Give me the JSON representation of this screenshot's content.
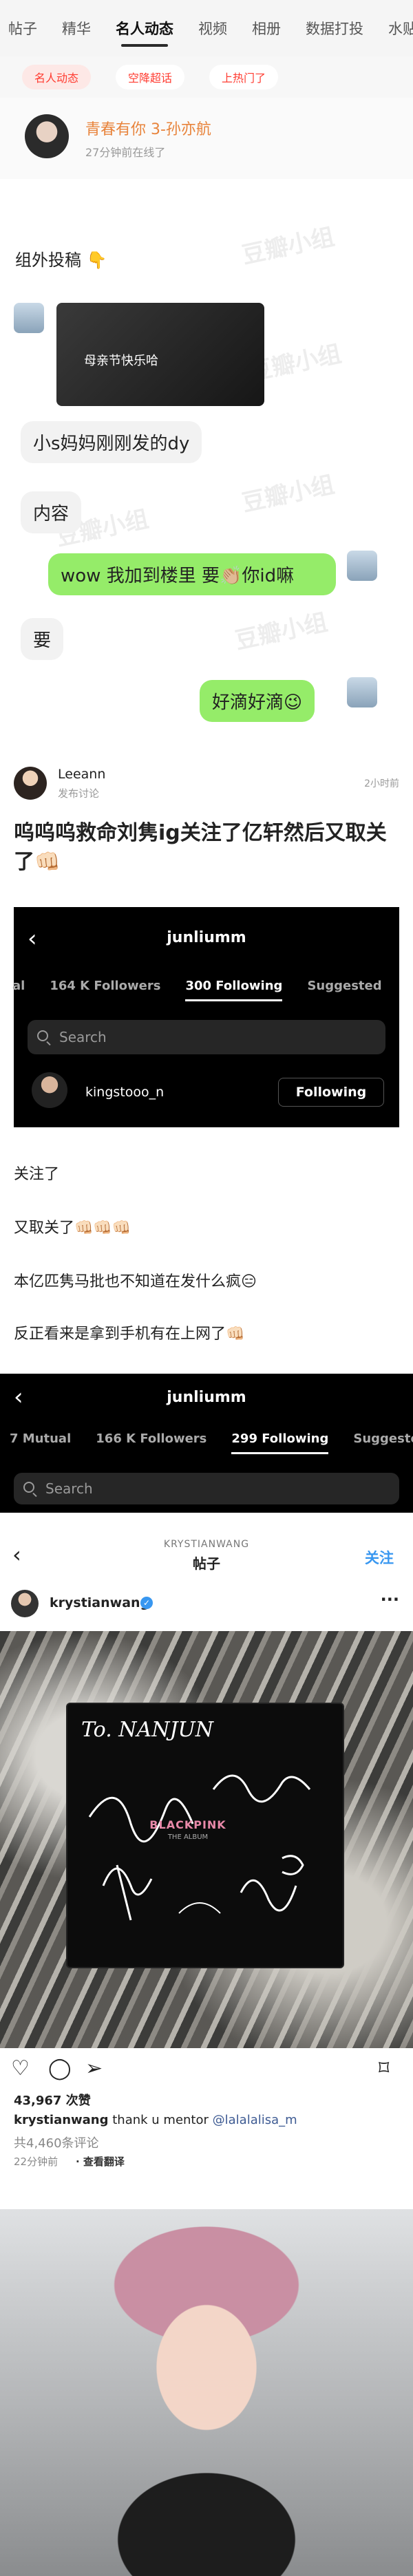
{
  "tabs": [
    "帖子",
    "精华",
    "名人动态",
    "视频",
    "相册",
    "数据打投",
    "水贴"
  ],
  "subtabs": [
    "名人动态",
    "空降超话",
    "上热门了"
  ],
  "celeb": {
    "name": "青春有你 3-孙亦航",
    "status": "27分钟前在线了"
  },
  "chat": {
    "title": "组外投稿 👇",
    "image_caption": "母亲节快乐哈",
    "msgs": [
      "小s妈妈刚刚发的dy",
      "内容",
      "wow 我加到楼里 要👏🏼你id嘛",
      "要",
      "好滴好滴😉"
    ]
  },
  "post": {
    "user": "Leeann",
    "source": "发布讨论",
    "time": "2小时前",
    "title": "呜呜呜救命刘隽ig关注了亿轩然后又取关了👊🏻"
  },
  "panel1": {
    "username": "junliumm",
    "tabs": [
      "al",
      "164 K Followers",
      "300 Following",
      "Suggested"
    ],
    "search_placeholder": "Search",
    "row_user": "kingstooo_n",
    "row_button": "Following"
  },
  "lines": [
    "关注了",
    "又取关了👊🏻👊🏻👊🏻",
    "本亿匹隽马批也不知道在发什么疯😑",
    "反正看来是拿到手机有在上网了👊🏻"
  ],
  "panel2": {
    "username": "junliumm",
    "tabs": [
      "7 Mutual",
      "166 K Followers",
      "299 Following",
      "Suggested"
    ],
    "search_placeholder": "Search"
  },
  "instagram": {
    "small_user": "KRYSTIANWANG",
    "title": "帖子",
    "follow": "关注",
    "user": "krystianwang",
    "album_text": "To. NANJUN",
    "album_brand": "BLACKPINK",
    "album_sub": "THE ALBUM",
    "likes": "43,967 次赞",
    "caption_user": "krystianwang",
    "caption_text": " thank u mentor ",
    "caption_mention": "@lalalalisa_m",
    "comments": "共4,460条评论",
    "time": "22分钟前",
    "translate": "· 查看翻译"
  },
  "watermark": "豆瓣小组"
}
